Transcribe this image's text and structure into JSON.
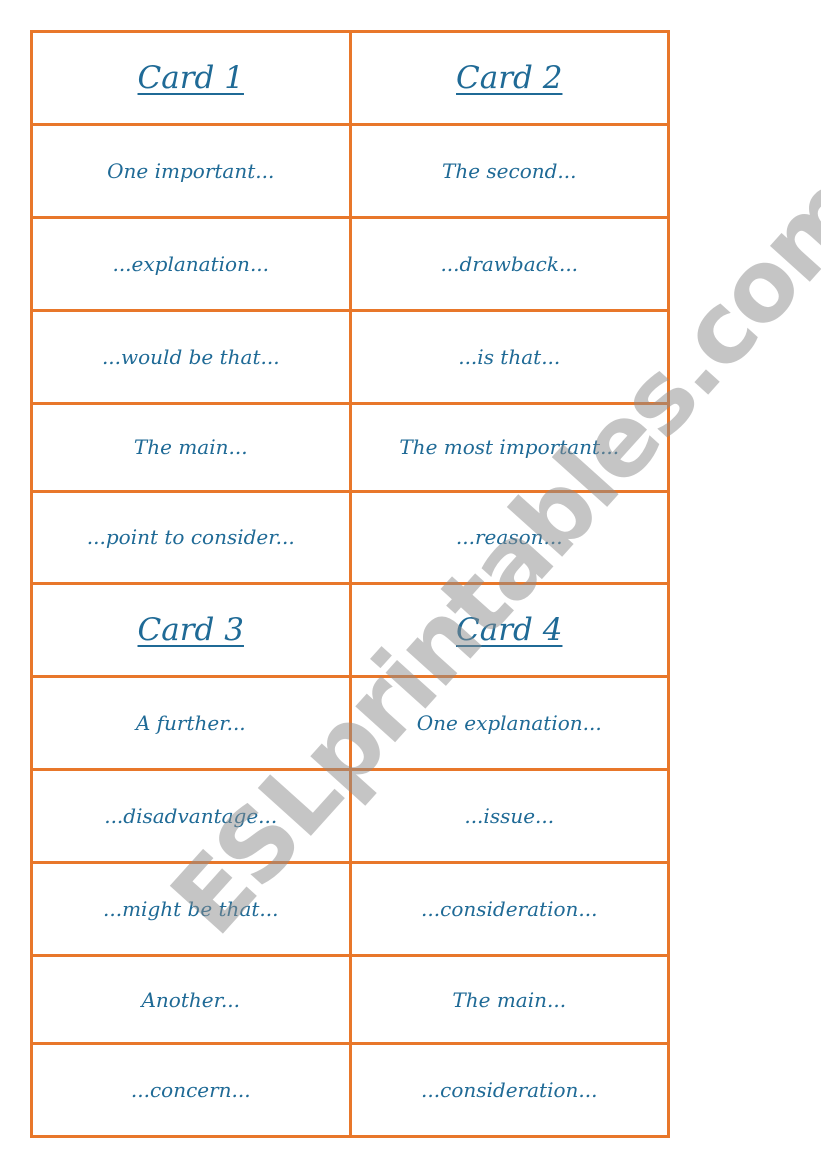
{
  "document": {
    "colors": {
      "border": "#E8772A",
      "text": "#1F6A96",
      "watermark": "#A0A0A0"
    },
    "watermark": "ESLprintables.com",
    "cards": [
      {
        "title": "Card 1",
        "phrases": [
          "One important...",
          "...explanation...",
          "...would be that...",
          "The main...",
          "...point to consider..."
        ]
      },
      {
        "title": "Card 2",
        "phrases": [
          "The second...",
          "...drawback...",
          "...is that...",
          "The most important...",
          "...reason..."
        ]
      },
      {
        "title": "Card 3",
        "phrases": [
          "A further...",
          "...disadvantage...",
          "...might be that...",
          "Another...",
          "...concern..."
        ]
      },
      {
        "title": "Card 4",
        "phrases": [
          "One explanation...",
          "...issue...",
          "...consideration...",
          "The main...",
          "...consideration..."
        ]
      }
    ]
  }
}
